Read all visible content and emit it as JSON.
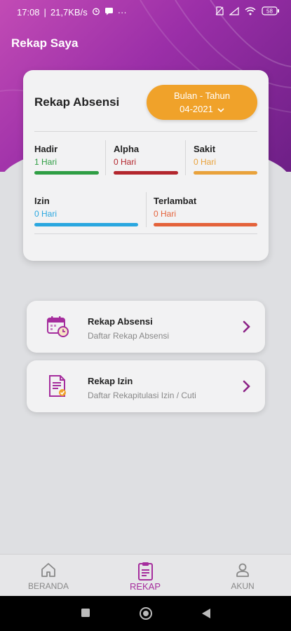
{
  "status_bar": {
    "time": "17:08",
    "speed": "21,7KB/s",
    "battery": "58"
  },
  "header": {
    "title": "Rekap Saya"
  },
  "recap": {
    "title": "Rekap Absensi",
    "period_label": "Bulan - Tahun",
    "period_value": "04-2021",
    "stats": [
      {
        "label": "Hadir",
        "value": "1 Hari",
        "color": "#2f9e44"
      },
      {
        "label": "Alpha",
        "value": "0 Hari",
        "color": "#b3262d"
      },
      {
        "label": "Sakit",
        "value": "0 Hari",
        "color": "#e9a23b"
      },
      {
        "label": "Izin",
        "value": "0 Hari",
        "color": "#2aa7e0"
      },
      {
        "label": "Terlambat",
        "value": "0 Hari",
        "color": "#e4623a"
      }
    ]
  },
  "menu": [
    {
      "title": "Rekap Absensi",
      "subtitle": "Daftar Rekap Absensi",
      "icon": "calendar-clock-icon"
    },
    {
      "title": "Rekap Izin",
      "subtitle": "Daftar Rekapitulasi Izin / Cuti",
      "icon": "document-icon"
    }
  ],
  "bottom_nav": [
    {
      "label": "BERANDA",
      "icon": "home-icon",
      "active": false
    },
    {
      "label": "REKAP",
      "icon": "clipboard-icon",
      "active": true
    },
    {
      "label": "AKUN",
      "icon": "user-icon",
      "active": false
    }
  ],
  "colors": {
    "accent": "#a52d9d",
    "period_button": "#f0a22a",
    "header_gradient_start": "#c24bb5",
    "header_gradient_end": "#6d1f86"
  }
}
